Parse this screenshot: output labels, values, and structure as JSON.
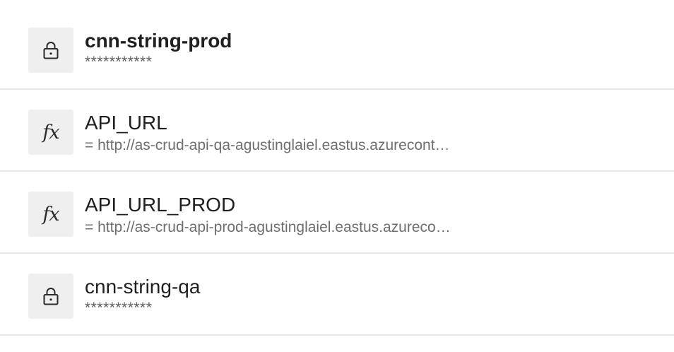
{
  "variables": [
    {
      "icon": "lock-icon",
      "name": "cnn-string-prod",
      "value": "***********",
      "secret": true,
      "selected": true
    },
    {
      "icon": "function-icon",
      "name": "API_URL",
      "value": "= http://as-crud-api-qa-agustinglaiel.eastus.azurecont…",
      "secret": false,
      "selected": false
    },
    {
      "icon": "function-icon",
      "name": "API_URL_PROD",
      "value": "= http://as-crud-api-prod-agustinglaiel.eastus.azureco…",
      "secret": false,
      "selected": false
    },
    {
      "icon": "lock-icon",
      "name": "cnn-string-qa",
      "value": "***********",
      "secret": true,
      "selected": false
    }
  ],
  "fx_glyph": "fx"
}
